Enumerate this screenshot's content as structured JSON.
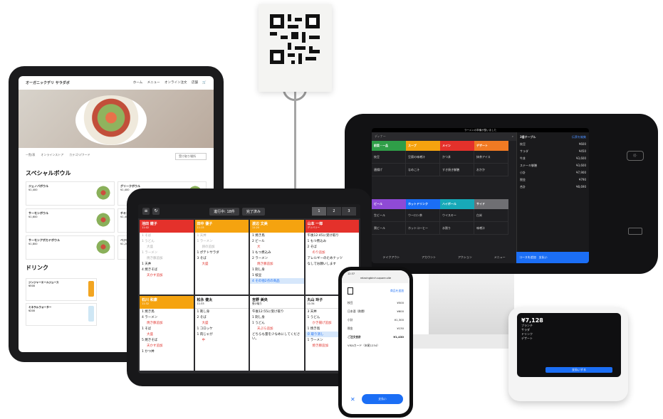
{
  "qr": {
    "alt": "QRコード"
  },
  "website": {
    "brand": "オーガニックデリ サラダボ",
    "nav": [
      "ホーム",
      "メニュー",
      "オンライン注文",
      "店舗"
    ],
    "filters": [
      "一覧/表",
      "オンラインストア",
      "カテゴリ/フード"
    ],
    "select_label": "受け取り場所",
    "section_title": "スペシャルボウル",
    "items": [
      {
        "name": "ジェノバボウル",
        "price": "¥1,400"
      },
      {
        "name": "グリークボウル",
        "price": "¥1,400"
      },
      {
        "name": "サーモンボウル",
        "price": "¥1,600"
      },
      {
        "name": "チキンボウル",
        "price": "¥1,400"
      },
      {
        "name": "サーモンアボカドボウル",
        "price": "¥1,800"
      },
      {
        "name": "ベジボウル",
        "price": "¥1,200"
      }
    ],
    "drink_title": "ドリンク",
    "drinks": [
      {
        "name": "ジンジャーエールジュース",
        "price": "¥500"
      },
      {
        "name": "ミネラルウォーター",
        "price": "¥200"
      }
    ]
  },
  "register": {
    "top": "ラーメンの準備が整いました",
    "search": "ディナー",
    "categories": [
      {
        "label": "前菜・一品",
        "color": "#2f9e48"
      },
      {
        "label": "スープ",
        "color": "#f5a30f"
      },
      {
        "label": "メイン",
        "color": "#e4312b"
      },
      {
        "label": "デザート",
        "color": "#f07a23"
      }
    ],
    "items1": [
      "枝豆",
      "豆腐の味噌汁",
      "かつ丼",
      "抹茶アイス",
      "唐揚げ",
      "なめこ汁",
      "すき焼き御膳",
      "おかか"
    ],
    "categories2": [
      {
        "label": "ビール",
        "color": "#8f4ad6"
      },
      {
        "label": "ホットドリンク",
        "color": "#1b6ef5"
      },
      {
        "label": "ハイボール",
        "color": "#17a9b8"
      },
      {
        "label": "サイド",
        "color": "#6f6f73"
      }
    ],
    "items2": [
      "生ビール",
      "ウーロン茶",
      "ウイスキー",
      "白米",
      "黒ビール",
      "ホットコーヒー",
      "水割り",
      "味噌汁"
    ],
    "footer": [
      "テイクアウト",
      "アカウント",
      "アクション",
      "メニュー"
    ],
    "side_title": "3番テーブル",
    "side_action": "伝票を編集",
    "lines": [
      {
        "name": "枝豆",
        "price": "¥600"
      },
      {
        "name": "サラダ",
        "price": "¥450"
      },
      {
        "name": "牛丼",
        "price": "¥3,600"
      },
      {
        "name": "ステーキ御膳",
        "price": "¥3,600"
      },
      {
        "name": "小計",
        "price": "¥7,900"
      },
      {
        "name": "税金",
        "price": "¥790"
      },
      {
        "name": "合計",
        "price": "¥8,690"
      }
    ],
    "pay_label": "コースを追加",
    "pay_sub": "支払い"
  },
  "reader": {
    "total": "¥7,128",
    "lines": [
      "ブランチ",
      "サラダ",
      "ドリンク",
      "デザート"
    ],
    "button": "支払いする"
  },
  "kds": {
    "status": "進行中: 18件",
    "done": "完了済み",
    "pages": [
      "1",
      "2",
      "3"
    ],
    "tickets": [
      {
        "name": "池田 健子",
        "sub": "11:02",
        "color": "#e4312b",
        "lines": [
          {
            "t": "1 そば",
            "done": true
          },
          {
            "t": "1 うどん",
            "done": true
          },
          {
            "t": "大盛",
            "done": true,
            "sub": true
          },
          {
            "t": "1 ラーメン",
            "done": true
          },
          {
            "t": "焼き豚追加",
            "done": true,
            "sub": true
          },
          {
            "t": "1 天丼"
          },
          {
            "t": "4 焼きそば"
          },
          {
            "t": "天かす追加",
            "sub": true
          }
        ]
      },
      {
        "name": "田中 優子",
        "sub": "11:15",
        "color": "#f5a30f",
        "lines": [
          {
            "t": "1 天丼",
            "done": true
          },
          {
            "t": "1 ラーメン",
            "done": true
          },
          {
            "t": "卵の追加",
            "done": true,
            "sub": true
          },
          {
            "t": "1 ポテトサラダ"
          },
          {
            "t": "3 そば"
          },
          {
            "t": "大盛",
            "sub": true
          }
        ]
      },
      {
        "name": "渡辺 文美",
        "sub": "11:20",
        "color": "#f5a30f",
        "lines": [
          {
            "t": "1 焼き鳥"
          },
          {
            "t": "2 ビール"
          },
          {
            "t": "大",
            "sub": true
          },
          {
            "t": "1 もつ煮込み"
          },
          {
            "t": "2 ラーメン"
          },
          {
            "t": "焼き豚追加",
            "sub": true
          },
          {
            "t": "1 刺し身"
          },
          {
            "t": "1 枝豆"
          },
          {
            "t": "4 その他2点の商品",
            "hl": true
          }
        ]
      },
      {
        "name": "山本 一郎",
        "sub": "デリバリー",
        "color": "#e4312b",
        "lines": [
          {
            "t": "午後12:45に受け取り"
          },
          {
            "t": "1 もつ煮込み"
          },
          {
            "t": "2 そば"
          },
          {
            "t": "のり追加",
            "sub": true
          },
          {
            "t": "アレルギーのためナッツ"
          },
          {
            "t": "なしでお願いします"
          }
        ]
      },
      {
        "name": "石川 和康",
        "sub": "11:32",
        "color": "#f5a30f",
        "lines": [
          {
            "t": "1 焼き鳥"
          },
          {
            "t": "4 ラーメン"
          },
          {
            "t": "焼き豚追加",
            "sub": true
          },
          {
            "t": "1 そば"
          },
          {
            "t": "大盛",
            "sub": true
          },
          {
            "t": "5 焼きそば"
          },
          {
            "t": "天かす追加",
            "sub": true
          },
          {
            "t": "1 かつ丼"
          }
        ]
      },
      {
        "name": "松永 健太",
        "sub": "11:33",
        "color": "#ffffff",
        "lines": [
          {
            "t": "1 刺し身"
          },
          {
            "t": "2 そば"
          },
          {
            "t": "大盛",
            "sub": true
          },
          {
            "t": "1 コロッケ"
          },
          {
            "t": "1 肉じゃが"
          },
          {
            "t": "中",
            "sub": true
          }
        ]
      },
      {
        "name": "吉野 美央",
        "sub": "受け取り",
        "color": "#ffffff",
        "lines": [
          {
            "t": "午後12:55に受け取り"
          },
          {
            "t": "1 刺し身"
          },
          {
            "t": "1 うどん"
          },
          {
            "t": "天ぷら追加",
            "sub": true
          },
          {
            "t": "どちらも量を少なめにしてください。"
          }
        ]
      },
      {
        "name": "丸山 玲子",
        "sub": "11:34",
        "color": "#ffffff",
        "lines": [
          {
            "t": "3 天丼"
          },
          {
            "t": "1 うどん"
          },
          {
            "t": "かき揚げ追加",
            "sub": true
          },
          {
            "t": "1 焼き鳥"
          },
          {
            "t": "⏱ 取り消し",
            "hl": true
          },
          {
            "t": "1 ラーメン"
          },
          {
            "t": "焼き豚追加",
            "sub": true
          }
        ]
      }
    ]
  },
  "phone": {
    "url": "relaxingbirch.square.site",
    "time": "12:37",
    "header_action": "商品を追加",
    "rows": [
      {
        "name": "枝豆",
        "price": "¥500"
      },
      {
        "name": "日本酒（熱燗）",
        "price": "¥600"
      },
      {
        "name": "小計",
        "price": "¥1,300"
      },
      {
        "name": "税金",
        "price": "¥130"
      },
      {
        "name": "ご注文合計",
        "price": "¥1,430"
      }
    ],
    "pay_method": "VISAカード（末尾1234）",
    "pay_button": "支払い"
  }
}
